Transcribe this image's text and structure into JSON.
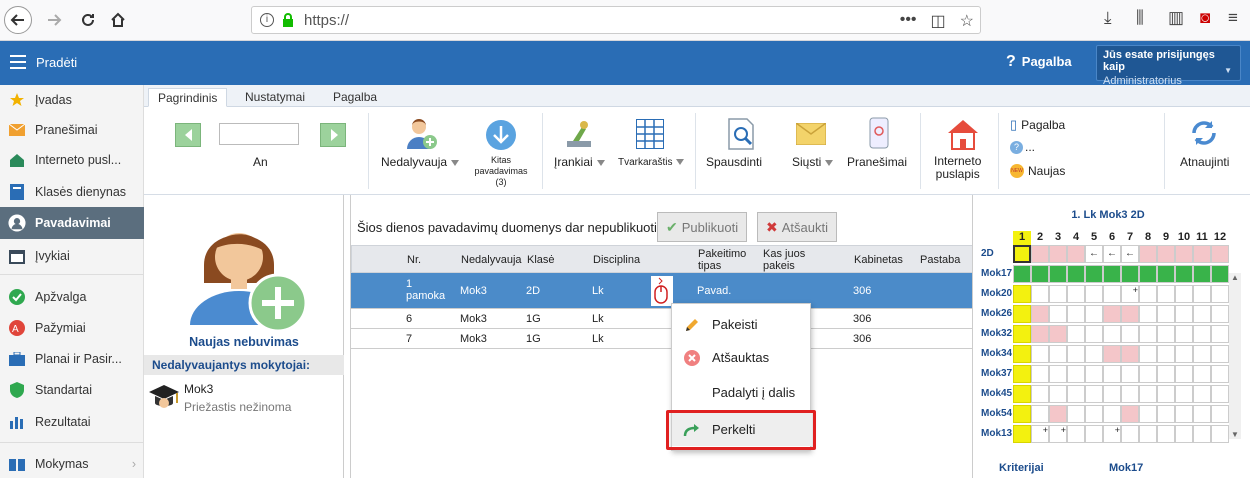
{
  "browser": {
    "url": "https://"
  },
  "header": {
    "title": "Pradėti",
    "help": "Pagalba",
    "login_line1": "Jūs esate prisijungęs kaip",
    "login_line2": "Administratorius"
  },
  "sidebar": {
    "items": [
      {
        "label": "Įvadas",
        "icon": "star-icon"
      },
      {
        "label": "Pranešimai",
        "icon": "envelope-icon"
      },
      {
        "label": "Interneto pusl...",
        "icon": "house-icon"
      },
      {
        "label": "Klasės dienynas",
        "icon": "book-icon"
      },
      {
        "label": "Pavadavimai",
        "icon": "person-icon"
      },
      {
        "label": "Įvykiai",
        "icon": "calendar-icon"
      },
      {
        "label": "Apžvalga",
        "icon": "check-circle-icon"
      },
      {
        "label": "Pažymiai",
        "icon": "grades-icon"
      },
      {
        "label": "Planai ir Pasir...",
        "icon": "briefcase-icon"
      },
      {
        "label": "Standartai",
        "icon": "shield-icon"
      },
      {
        "label": "Rezultatai",
        "icon": "bar-chart-icon"
      },
      {
        "label": "Mokymas",
        "icon": "book-open-icon"
      }
    ]
  },
  "ribbon_tabs": [
    "Pagrindinis",
    "Nustatymai",
    "Pagalba"
  ],
  "ribbon": {
    "date_label": "An",
    "date_value": "",
    "nedalyvauja": "Nedalyvauja",
    "kitas_line1": "Kitas",
    "kitas_line2": "pavadavimas",
    "kitas_line3": "(3)",
    "irankiai": "Įrankiai",
    "tvarkarastis": "Tvarkaraštis",
    "spausdinti": "Spausdinti",
    "siusti": "Siųsti",
    "pranesimai": "Pranešimai",
    "interneto_line1": "Interneto",
    "interneto_line2": "puslapis",
    "pagalba": "Pagalba",
    "dots": "...",
    "naujas": "Naujas",
    "atnaujinti": "Atnaujinti"
  },
  "left_panel": {
    "new_absence": "Naujas nebuvimas",
    "section_title": "Nedalyvaujantys mokytojai:",
    "teacher": "Mok3",
    "reason": "Priežastis nežinoma"
  },
  "main": {
    "notice": "Šios dienos pavadavimų duomenys dar nepublikuoti.",
    "publish_btn": "Publikuoti",
    "cancel_btn": "Atšaukti",
    "headers": {
      "nr": "Nr.",
      "nedalyvauja": "Nedalyvauja",
      "klase": "Klasė",
      "disciplina": "Disciplina",
      "pakeitimo_line1": "Pakeitimo",
      "pakeitimo_line2": "tipas",
      "kas_line1": "Kas juos",
      "kas_line2": "pakeis",
      "kabinetas": "Kabinetas",
      "pastaba": "Pastaba"
    },
    "rows": [
      {
        "nr_line1": "1",
        "nr_line2": "pamoka",
        "teacher": "Mok3",
        "klase": "2D",
        "disc": "Lk",
        "tipas": "Pavad.",
        "kab": "306"
      },
      {
        "nr_line1": "6",
        "nr_line2": "",
        "teacher": "Mok3",
        "klase": "1G",
        "disc": "Lk",
        "tipas": "",
        "kab": "306"
      },
      {
        "nr_line1": "7",
        "nr_line2": "",
        "teacher": "Mok3",
        "klase": "1G",
        "disc": "Lk",
        "tipas": "",
        "kab": "306"
      }
    ]
  },
  "context_menu": {
    "items": [
      "Pakeisti",
      "Atšauktas",
      "Padalyti į dalis",
      "Perkelti"
    ]
  },
  "schedule": {
    "title": "1. Lk Mok3 2D",
    "columns": [
      "1",
      "2",
      "3",
      "4",
      "5",
      "6",
      "7",
      "8",
      "9",
      "10",
      "11",
      "12"
    ],
    "rows": [
      "2D",
      "Mok17",
      "Mok20",
      "Mok26",
      "Mok32",
      "Mok34",
      "Mok37",
      "Mok45",
      "Mok54",
      "Mok13"
    ],
    "arrow": "←",
    "plus": "+",
    "footer_left": "Kriterijai",
    "footer_right": "Mok17",
    "colors": {
      "green": "#39b34a",
      "pink": "#f4c6c9",
      "yellow": "#f3f10f"
    }
  }
}
